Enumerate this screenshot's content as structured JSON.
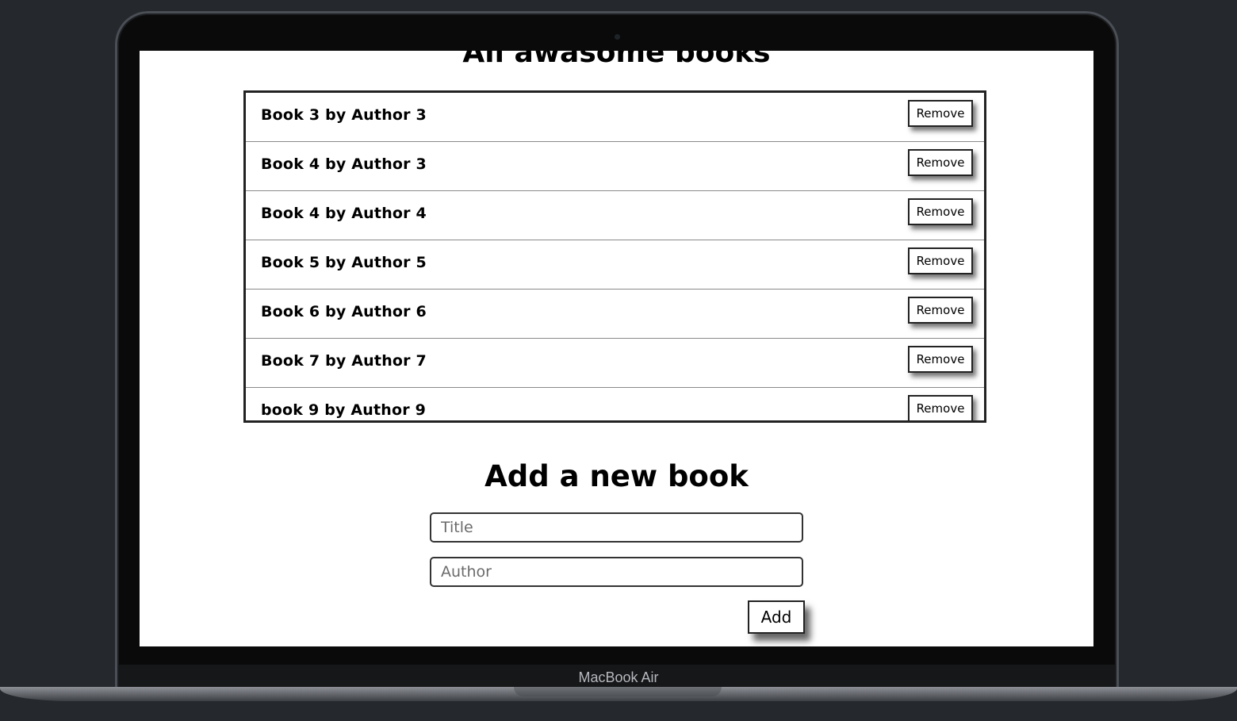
{
  "device": {
    "label": "MacBook Air"
  },
  "page": {
    "title": "All awasome books"
  },
  "books": [
    {
      "text": "Book 3 by Author 3",
      "remove_label": "Remove"
    },
    {
      "text": "Book 4 by Author 3",
      "remove_label": "Remove"
    },
    {
      "text": "Book 4 by Author 4",
      "remove_label": "Remove"
    },
    {
      "text": "Book 5 by Author 5",
      "remove_label": "Remove"
    },
    {
      "text": "Book 6 by Author 6",
      "remove_label": "Remove"
    },
    {
      "text": "Book 7 by Author 7",
      "remove_label": "Remove"
    },
    {
      "text": "book 9 by Author 9",
      "remove_label": "Remove"
    }
  ],
  "form": {
    "heading": "Add a new book",
    "title_placeholder": "Title",
    "author_placeholder": "Author",
    "title_value": "",
    "author_value": "",
    "add_label": "Add"
  }
}
